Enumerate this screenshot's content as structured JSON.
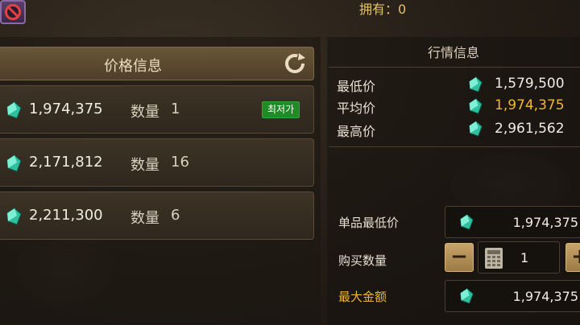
{
  "top": {
    "own_label": "拥有：",
    "own_value": "0"
  },
  "price_panel": {
    "title": "价格信息",
    "rows": [
      {
        "price": "1,974,375",
        "qty_label": "数量",
        "qty": "1",
        "badge": "최저가"
      },
      {
        "price": "2,171,812",
        "qty_label": "数量",
        "qty": "16",
        "badge": ""
      },
      {
        "price": "2,211,300",
        "qty_label": "数量",
        "qty": "6",
        "badge": ""
      }
    ]
  },
  "market_panel": {
    "title": "行情信息",
    "stats": [
      {
        "label": "最低价",
        "value": "1,579,500"
      },
      {
        "label": "平均价",
        "value": "1,974,375"
      },
      {
        "label": "最高价",
        "value": "2,961,562"
      }
    ]
  },
  "purchase": {
    "unit_min_label": "单品最低价",
    "unit_min_value": "1,974,375",
    "qty_label": "购买数量",
    "qty_value": "1",
    "minus_label": "−",
    "plus_label": "+",
    "max_amount_label": "最大金额",
    "max_amount_value": "1,974,375"
  },
  "colors": {
    "gold_text": "#f2b633",
    "badge_green": "#1f8a26",
    "gem_teal": "#3fd4b4"
  },
  "icons": [
    "cancel-icon",
    "refresh-icon",
    "gem-icon",
    "calculator-icon"
  ]
}
